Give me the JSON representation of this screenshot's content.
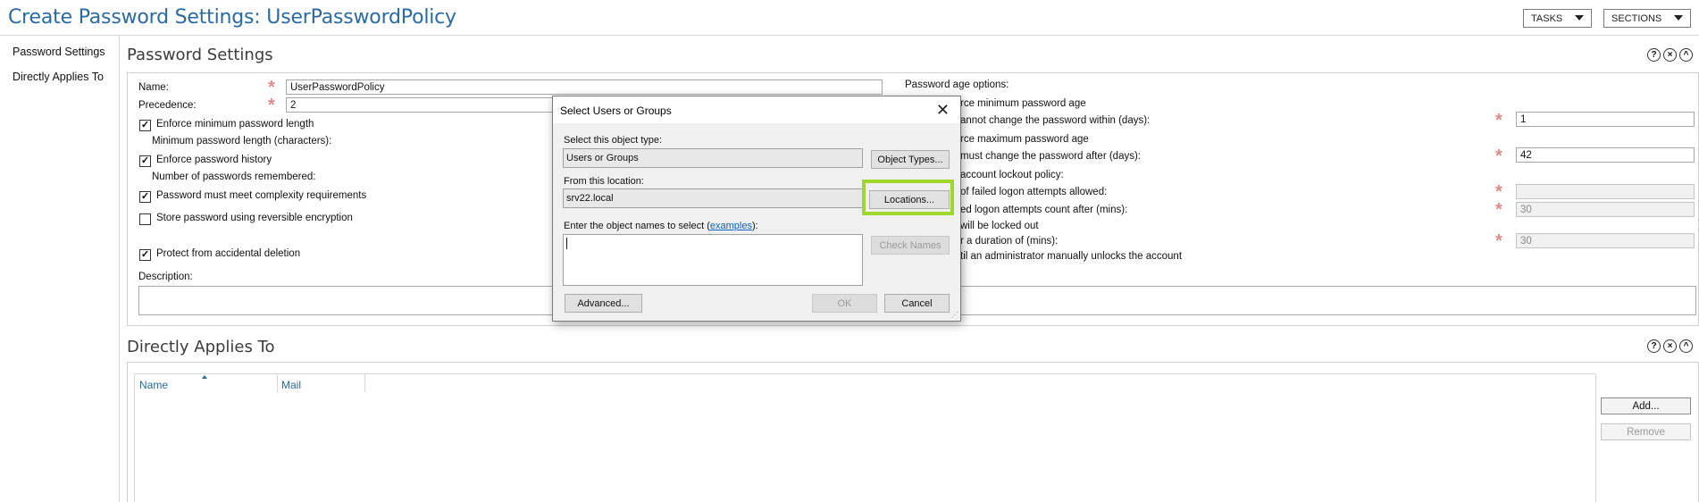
{
  "header": {
    "title": "Create Password Settings: UserPasswordPolicy",
    "tasks_label": "TASKS",
    "sections_label": "SECTIONS"
  },
  "nav": {
    "items": [
      {
        "label": "Password Settings"
      },
      {
        "label": "Directly Applies To"
      }
    ]
  },
  "password_settings": {
    "section_title": "Password Settings",
    "help_icon": "?",
    "close_icon": "×",
    "collapse_icon": "^",
    "name_label": "Name:",
    "name_value": "UserPasswordPolicy",
    "precedence_label": "Precedence:",
    "precedence_value": "2",
    "enforce_min_length_label": "Enforce minimum password length",
    "min_length_label": "Minimum password length (characters):",
    "enforce_history_label": "Enforce password history",
    "history_label": "Number of passwords remembered:",
    "complexity_label": "Password must meet complexity requirements",
    "reversible_label": "Store password using reversible encryption",
    "protect_label": "Protect from accidental deletion",
    "description_label": "Description:",
    "checkbox_states": {
      "enforce_min_length": true,
      "enforce_history": true,
      "complexity": true,
      "reversible": false,
      "protect": true
    },
    "age_options_label": "Password age options:",
    "right_frag_1": "rce minimum password age",
    "right_frag_2": "annot change the password within (days):",
    "right_value_1": "1",
    "right_frag_3": "rce maximum password age",
    "right_frag_4": "must change the password after (days):",
    "right_value_2": "42",
    "right_frag_5": "account lockout policy:",
    "right_frag_6": "of failed logon attempts allowed:",
    "right_frag_7": "ed logon attempts count after (mins):",
    "right_value_3": "30",
    "right_frag_8": "will be locked out",
    "right_frag_9": "r a duration of (mins):",
    "right_value_4": "30",
    "right_frag_10": "til an administrator manually unlocks the account"
  },
  "applies_to": {
    "section_title": "Directly Applies To",
    "columns": [
      "Name",
      "Mail"
    ],
    "add_label": "Add...",
    "remove_label": "Remove"
  },
  "dialog": {
    "title": "Select Users or Groups",
    "close_glyph": "✕",
    "object_type_label": "Select this object type:",
    "object_type_value": "Users or Groups",
    "object_types_button": "Object Types...",
    "location_label": "From this location:",
    "location_value": "srv22.local",
    "locations_button": "Locations...",
    "names_label_prefix": "Enter the object names to select (",
    "names_label_link": "examples",
    "names_label_suffix": "):",
    "check_names_button": "Check Names",
    "advanced_button": "Advanced...",
    "ok_button": "OK",
    "cancel_button": "Cancel"
  },
  "colors": {
    "title_blue": "#2a6aa0",
    "required_asterisk": "#e08a8a",
    "highlight_green": "#9fd82a",
    "link_blue": "#0a5fc4"
  }
}
